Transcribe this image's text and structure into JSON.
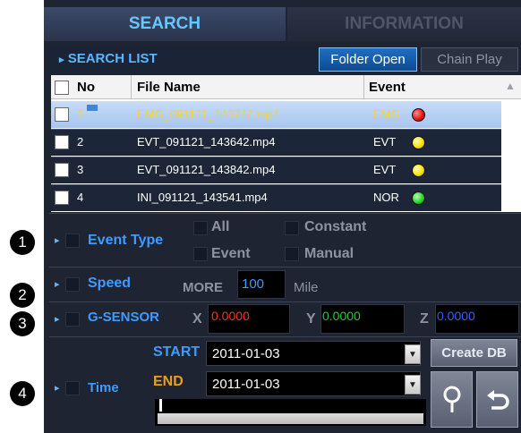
{
  "tabs": {
    "search": "SEARCH",
    "information": "INFORMATION"
  },
  "search_list": {
    "title": "SEARCH LIST",
    "folder_open": "Folder Open",
    "chain_play": "Chain Play",
    "columns": {
      "no": "No",
      "file_name": "File Name",
      "event": "Event"
    },
    "rows": [
      {
        "no": "1",
        "file": "EMG_091121_143742.mp4",
        "event": "EMG",
        "status_color": "red"
      },
      {
        "no": "2",
        "file": "EVT_091121_143642.mp4",
        "event": "EVT",
        "status_color": "yellow"
      },
      {
        "no": "3",
        "file": "EVT_091121_143842.mp4",
        "event": "EVT",
        "status_color": "yellow"
      },
      {
        "no": "4",
        "file": "INI_091121_143541.mp4",
        "event": "NOR",
        "status_color": "green"
      }
    ]
  },
  "callouts": [
    "1",
    "2",
    "3",
    "4"
  ],
  "event_type": {
    "label": "Event Type",
    "options": {
      "all": "All",
      "constant": "Constant",
      "event": "Event",
      "manual": "Manual"
    }
  },
  "speed": {
    "label": "Speed",
    "more": "MORE",
    "value": "100",
    "unit": "Mile"
  },
  "gsensor": {
    "label": "G-SENSOR",
    "x_label": "X",
    "x": "0.0000",
    "y_label": "Y",
    "y": "0.0000",
    "z_label": "Z",
    "z": "0.0000"
  },
  "time": {
    "label": "Time",
    "start_label": "START",
    "start_date": "2011-01-03",
    "end_label": "END",
    "end_date": "2011-01-03",
    "create_db": "Create DB"
  },
  "icons": {
    "search": "search-icon",
    "back": "return-arrow-icon",
    "dropdown": "chevron-down-icon",
    "list_arrow": "triangle-right-icon"
  },
  "colors": {
    "accent_blue": "#3e9bff",
    "selected_text": "#ffd21e",
    "x_value": "#ff2a2a",
    "y_value": "#29c63a",
    "z_value": "#3a5cff",
    "start_end": "#e8a020"
  }
}
